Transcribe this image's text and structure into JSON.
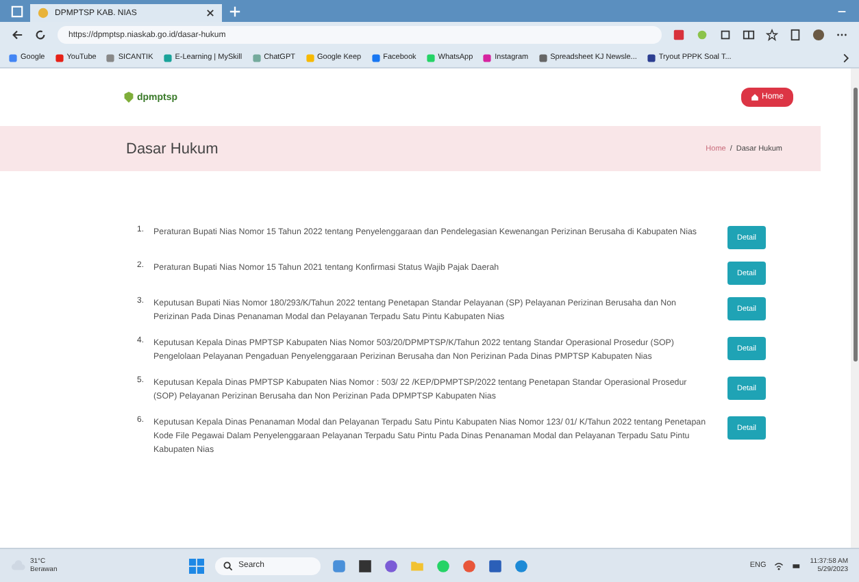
{
  "browser": {
    "tab_title": "DPMPTSP KAB. NIAS",
    "url": "https://dpmptsp.niaskab.go.id/dasar-hukum",
    "bookmarks": [
      {
        "label": "Google",
        "color": "#4285f4"
      },
      {
        "label": "YouTube",
        "color": "#e62117"
      },
      {
        "label": "SICANTIK",
        "color": "#888888"
      },
      {
        "label": "E-Learning | MySkill",
        "color": "#1aa39a"
      },
      {
        "label": "ChatGPT",
        "color": "#74aa9c"
      },
      {
        "label": "Google Keep",
        "color": "#f7b900"
      },
      {
        "label": "Facebook",
        "color": "#1877f2"
      },
      {
        "label": "WhatsApp",
        "color": "#25d366"
      },
      {
        "label": "Instagram",
        "color": "#d6249f"
      },
      {
        "label": "Spreadsheet KJ Newsle...",
        "color": "#666666"
      },
      {
        "label": "Tryout PPPK Soal T...",
        "color": "#2c3e91"
      }
    ]
  },
  "site": {
    "logo_text": "dpmptsp",
    "home_button": "Home",
    "page_title": "Dasar Hukum",
    "breadcrumb": [
      "Home",
      "Dasar Hukum"
    ],
    "breadcrumb_separator": "/",
    "documents": [
      {
        "number": "1.",
        "text": "Peraturan Bupati Nias Nomor 15 Tahun 2022 tentang Penyelenggaraan dan Pendelegasian Kewenangan Perizinan Berusaha di Kabupaten Nias",
        "button": "Detail"
      },
      {
        "number": "2.",
        "text": "Peraturan Bupati Nias Nomor 15 Tahun 2021 tentang Konfirmasi Status Wajib Pajak Daerah",
        "button": "Detail"
      },
      {
        "number": "3.",
        "text": "Keputusan Bupati Nias Nomor 180/293/K/Tahun 2022 tentang Penetapan Standar Pelayanan (SP) Pelayanan Perizinan Berusaha dan Non Perizinan Pada Dinas Penanaman Modal dan Pelayanan Terpadu Satu Pintu Kabupaten Nias",
        "button": "Detail"
      },
      {
        "number": "4.",
        "text": "Keputusan Kepala Dinas PMPTSP Kabupaten Nias Nomor 503/20/DPMPTSP/K/Tahun 2022 tentang Standar Operasional Prosedur (SOP) Pengelolaan Pelayanan Pengaduan Penyelenggaraan Perizinan Berusaha dan Non Perizinan Pada Dinas PMPTSP Kabupaten Nias",
        "button": "Detail"
      },
      {
        "number": "5.",
        "text": "Keputusan Kepala Dinas PMPTSP Kabupaten Nias Nomor : 503/ 22 /KEP/DPMPTSP/2022 tentang Penetapan Standar Operasional Prosedur (SOP) Pelayanan Perizinan Berusaha dan Non Perizinan Pada DPMPTSP Kabupaten Nias",
        "button": "Detail"
      },
      {
        "number": "6.",
        "text": "Keputusan Kepala Dinas Penanaman Modal dan Pelayanan Terpadu Satu Pintu Kabupaten Nias Nomor 123/ 01/ K/Tahun 2022 tentang Penetapan Kode File Pegawai Dalam Penyelenggaraan Pelayanan Terpadu Satu Pintu Pada Dinas Penanaman Modal dan Pelayanan Terpadu Satu Pintu Kabupaten Nias",
        "button": "Detail"
      }
    ]
  },
  "taskbar": {
    "weather_temp": "31°C",
    "weather_text": "Berawan",
    "search": "Search",
    "language": "ENG",
    "time": "11:37:58 AM",
    "date": "5/29/2023"
  }
}
